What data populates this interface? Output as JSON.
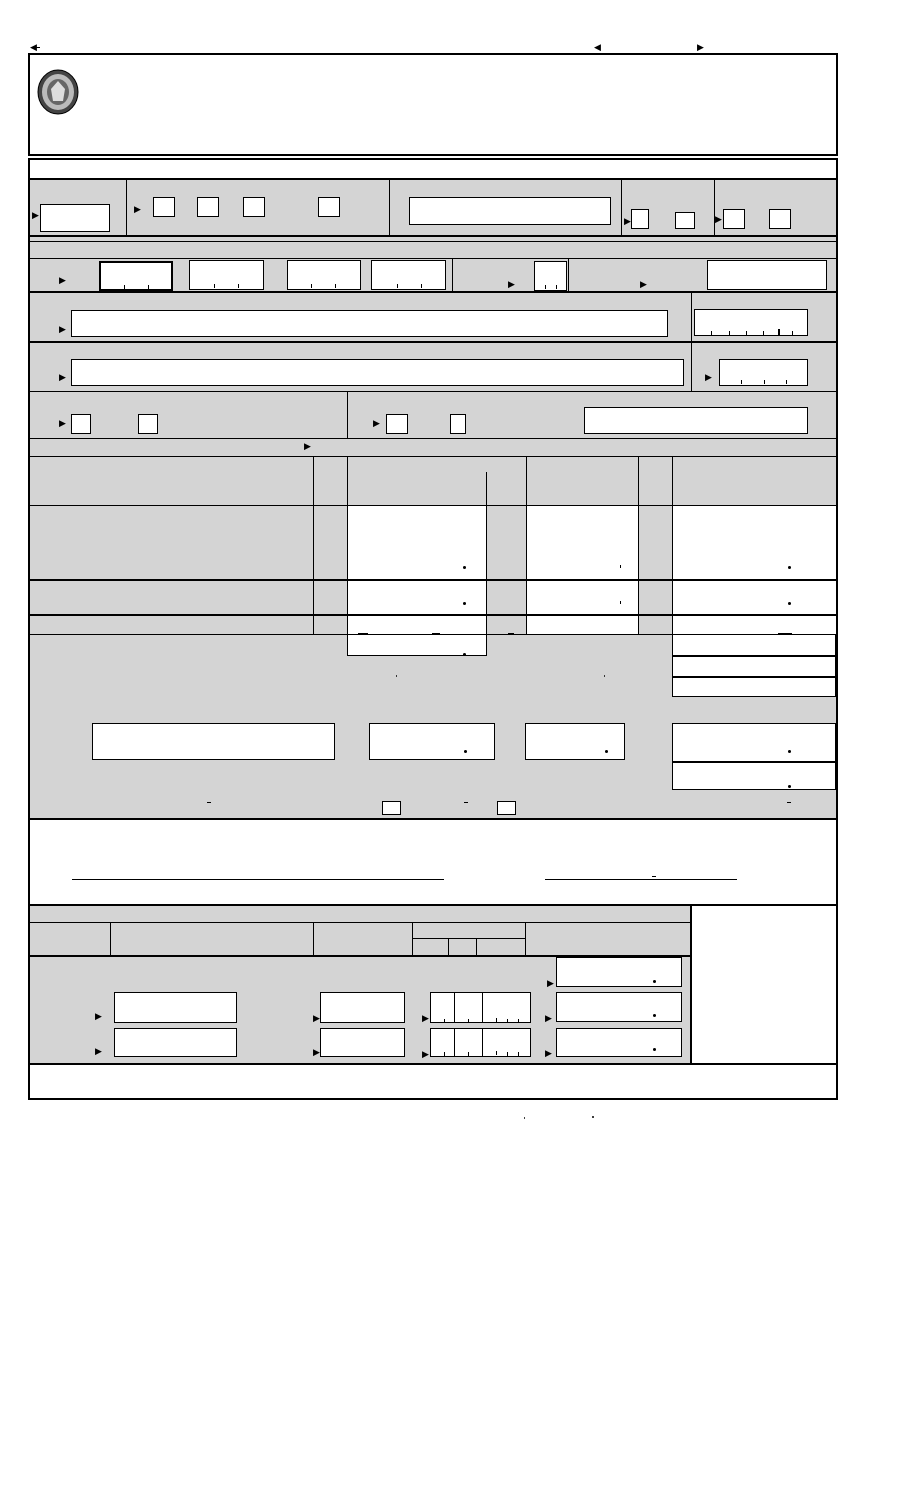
{
  "colors": {
    "panel": "#d4d4d4",
    "border": "#000000",
    "field": "#ffffff"
  },
  "icons": {
    "seal": "state-seal-icon",
    "arrow": "pointer-arrow-icon"
  }
}
